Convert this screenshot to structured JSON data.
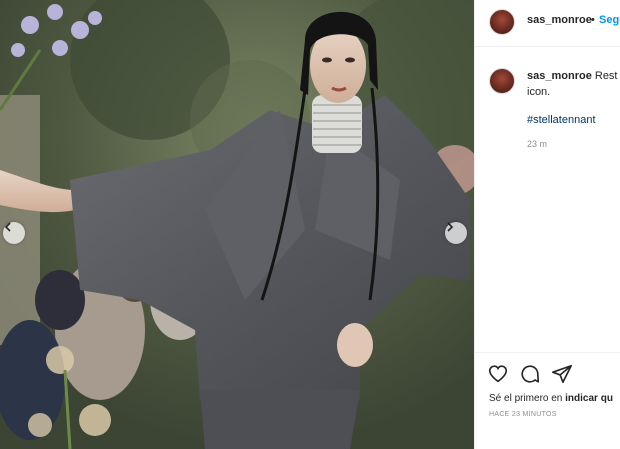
{
  "post": {
    "image_alt": "Fashion photo: model in grey wool suit with silver neck rings",
    "header": {
      "username": "sas_monroe",
      "separator": "•",
      "follow_label": "Segu"
    },
    "caption": {
      "username": "sas_monroe",
      "text_line1": "Rest in",
      "text_line2": "icon.",
      "hashtag": "#stellatennant",
      "time_ago": "23 m"
    },
    "actions": {
      "like_icon": "heart-icon",
      "comment_icon": "comment-icon",
      "share_icon": "share-icon"
    },
    "likes": {
      "prefix": "Sé el primero en ",
      "cta": "indicar qu"
    },
    "timestamp": "HACE 23 MINUTOS",
    "colors": {
      "link_blue": "#0095f6",
      "hashtag": "#00376b",
      "muted": "#8e8e8e",
      "text": "#262626"
    }
  }
}
